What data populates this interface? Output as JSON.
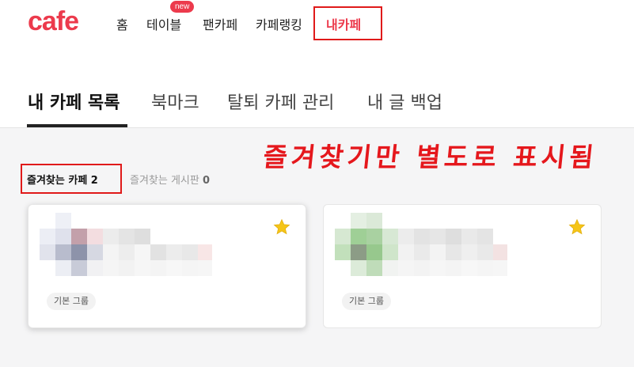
{
  "header": {
    "logo": "cafe",
    "nav": {
      "home": "홈",
      "table": "테이블",
      "table_badge": "new",
      "fancafe": "팬카페",
      "ranking": "카페랭킹",
      "mycafe": "내카페"
    }
  },
  "tabs": {
    "list": "내 카페 목록",
    "bookmark": "북마크",
    "manage": "탈퇴 카페 관리",
    "backup": "내 글 백업"
  },
  "annotation": "즐겨찾기만 별도로 표시됨",
  "subtabs": {
    "fav_cafe": "즐겨찾는 카페 2",
    "fav_board_label": "즐겨찾는 게시판",
    "fav_board_count": "0"
  },
  "cards": [
    {
      "group": "기본 그룹",
      "starred": true
    },
    {
      "group": "기본 그룹",
      "starred": true
    }
  ],
  "colors": {
    "brand": "#ec3a4c",
    "highlight_box": "#e01a1a",
    "star": "#f5c518"
  }
}
